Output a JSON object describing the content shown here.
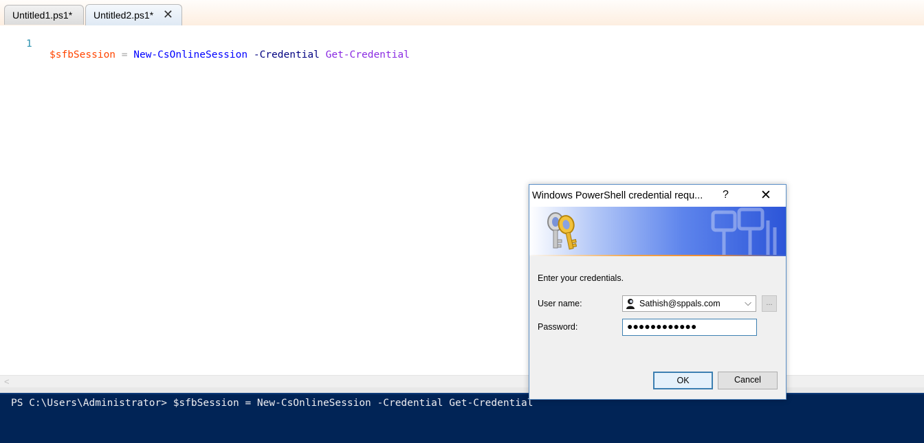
{
  "tabs": [
    {
      "label": "Untitled1.ps1*",
      "active": false
    },
    {
      "label": "Untitled2.ps1*",
      "active": true
    }
  ],
  "editor": {
    "line_number": "1",
    "tokens": {
      "variable": "$sfbSession",
      "operator": "=",
      "command": "New-CsOnlineSession",
      "parameter": "-Credential",
      "argument": "Get-Credential"
    }
  },
  "console": {
    "line": "PS C:\\Users\\Administrator> $sfbSession = New-CsOnlineSession -Credential Get-Credential"
  },
  "dialog": {
    "title": "Windows PowerShell credential requ...",
    "help_label": "?",
    "prompt": "Enter your credentials.",
    "user_label": "User name:",
    "user_value": "Sathish@sppals.com",
    "password_label": "Password:",
    "password_mask": "●●●●●●●●●●●●",
    "browse_label": "...",
    "ok_label": "OK",
    "cancel_label": "Cancel"
  },
  "colors": {
    "console_bg": "#012456",
    "token_variable": "#ff4500",
    "token_command": "#0000ff",
    "token_parameter": "#000080",
    "token_argument": "#8a2be2"
  }
}
